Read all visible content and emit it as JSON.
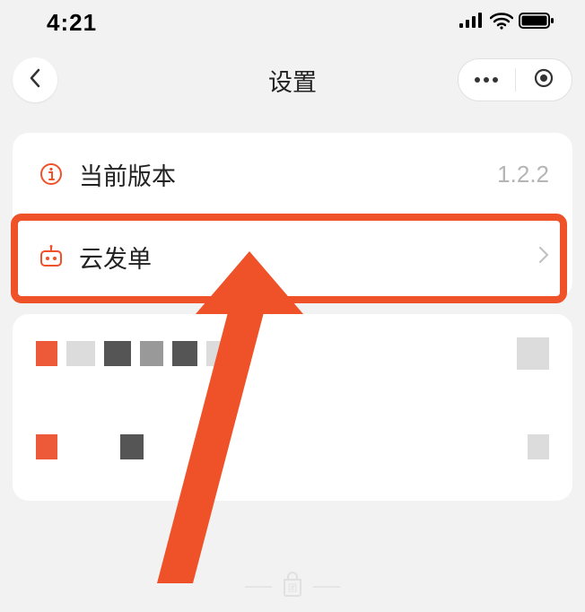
{
  "status": {
    "time": "4:21"
  },
  "nav": {
    "title": "设置"
  },
  "rows": {
    "version": {
      "label": "当前版本",
      "value": "1.2.2"
    },
    "cloud": {
      "label": "云发单"
    }
  },
  "colors": {
    "accent": "#ef5128"
  }
}
